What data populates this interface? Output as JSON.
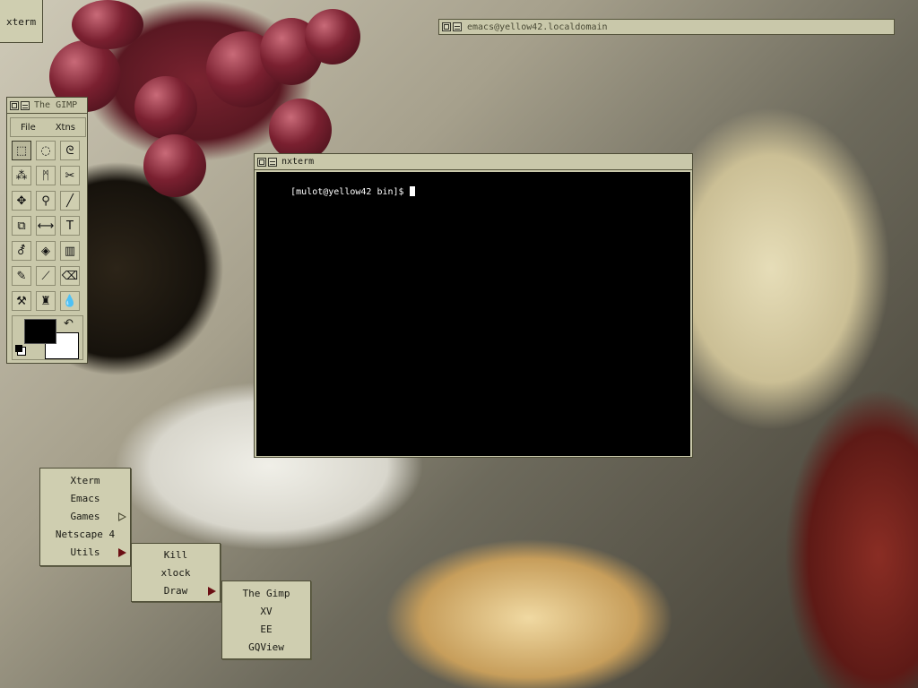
{
  "desktop": {
    "xterm_icon_label": "xterm"
  },
  "emacs_window": {
    "title": "emacs@yellow42.localdomain"
  },
  "gimp_window": {
    "title": "The GIMP",
    "menus": [
      "File",
      "Xtns"
    ],
    "tools": [
      {
        "name": "rect-select-icon",
        "glyph": "⬚"
      },
      {
        "name": "ellipse-select-icon",
        "glyph": "◌"
      },
      {
        "name": "lasso-select-icon",
        "glyph": "ᘓ"
      },
      {
        "name": "magic-wand-icon",
        "glyph": "⁂"
      },
      {
        "name": "bezier-select-icon",
        "glyph": "ᛗ"
      },
      {
        "name": "scissors-icon",
        "glyph": "✂"
      },
      {
        "name": "move-icon",
        "glyph": "✥"
      },
      {
        "name": "magnify-icon",
        "glyph": "⚲"
      },
      {
        "name": "crop-icon",
        "glyph": "╱"
      },
      {
        "name": "transform-icon",
        "glyph": "⧉"
      },
      {
        "name": "flip-icon",
        "glyph": "⟷"
      },
      {
        "name": "text-icon",
        "glyph": "T"
      },
      {
        "name": "color-picker-icon",
        "glyph": "⚦"
      },
      {
        "name": "bucket-fill-icon",
        "glyph": "◈"
      },
      {
        "name": "gradient-icon",
        "glyph": "▥"
      },
      {
        "name": "pencil-icon",
        "glyph": "✎"
      },
      {
        "name": "paintbrush-icon",
        "glyph": "⟋"
      },
      {
        "name": "eraser-icon",
        "glyph": "⌫"
      },
      {
        "name": "airbrush-icon",
        "glyph": "⚒"
      },
      {
        "name": "clone-stamp-icon",
        "glyph": "♜"
      },
      {
        "name": "blur-icon",
        "glyph": "💧"
      }
    ],
    "fg_color": "#000000",
    "bg_color": "#ffffff"
  },
  "nxterm_window": {
    "title": "nxterm",
    "prompt": "[mulot@yellow42 bin]$ "
  },
  "root_menu": {
    "items": [
      "Xterm",
      "Emacs",
      "Games",
      "Netscape 4",
      "Utils"
    ]
  },
  "utils_menu": {
    "items": [
      "Kill",
      "xlock",
      "Draw"
    ]
  },
  "draw_menu": {
    "items": [
      "The Gimp",
      "XV",
      "EE",
      "GQView"
    ]
  }
}
